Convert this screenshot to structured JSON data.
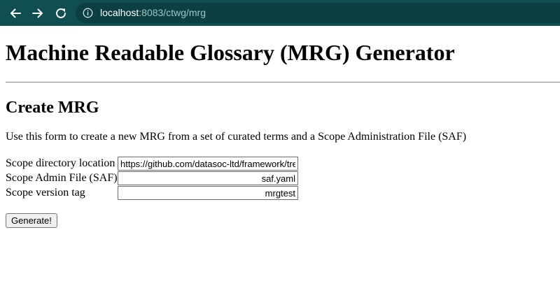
{
  "browser": {
    "url_host": "localhost",
    "url_rest": ":8083/ctwg/mrg",
    "back_icon": "arrow-left-icon",
    "forward_icon": "arrow-right-icon",
    "reload_icon": "reload-icon",
    "info_icon": "info-icon",
    "colors": {
      "toolbar": "#0f4f52",
      "url_box": "#0c3f42"
    }
  },
  "page": {
    "title": "Machine Readable Glossary (MRG) Generator",
    "subtitle": "Create MRG",
    "description": "Use this form to create a new MRG from a set of curated terms and a Scope Administration File (SAF)"
  },
  "form": {
    "fields": [
      {
        "label": "Scope directory location",
        "value": "https://github.com/datasoc-ltd/framework/tree/main"
      },
      {
        "label": "Scope Admin File (SAF)",
        "value": "saf.yaml"
      },
      {
        "label": "Scope version tag",
        "value": "mrgtest"
      }
    ],
    "submit_label": "Generate!"
  }
}
